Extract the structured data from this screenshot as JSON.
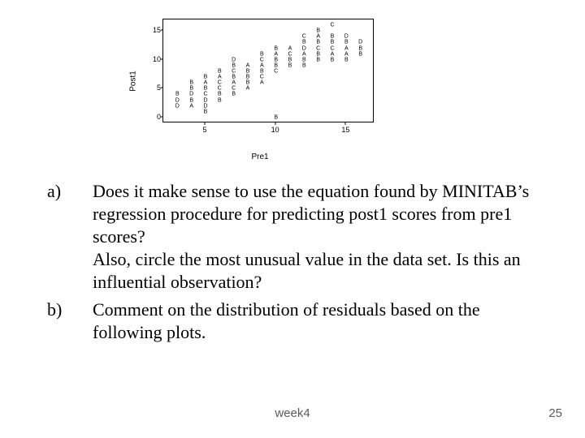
{
  "chart_data": {
    "type": "scatter",
    "title": "",
    "xlabel": "Pre1",
    "ylabel": "Post1",
    "xlim": [
      2,
      17
    ],
    "ylim": [
      -1,
      17
    ],
    "xticks": [
      5,
      10,
      15
    ],
    "yticks": [
      0,
      5,
      10,
      15
    ],
    "grid": false,
    "legend": false,
    "point_labels_note": "each point plotted with single-letter label",
    "points": [
      {
        "x": 3,
        "y": 4,
        "label": "B"
      },
      {
        "x": 3,
        "y": 3,
        "label": "D"
      },
      {
        "x": 3,
        "y": 2,
        "label": "D"
      },
      {
        "x": 4,
        "y": 6,
        "label": "B"
      },
      {
        "x": 4,
        "y": 5,
        "label": "B"
      },
      {
        "x": 4,
        "y": 4,
        "label": "D"
      },
      {
        "x": 4,
        "y": 3,
        "label": "B"
      },
      {
        "x": 4,
        "y": 2,
        "label": "A"
      },
      {
        "x": 5,
        "y": 7,
        "label": "B"
      },
      {
        "x": 5,
        "y": 6,
        "label": "A"
      },
      {
        "x": 5,
        "y": 5,
        "label": "B"
      },
      {
        "x": 5,
        "y": 4,
        "label": "C"
      },
      {
        "x": 5,
        "y": 3,
        "label": "D"
      },
      {
        "x": 5,
        "y": 2,
        "label": "D"
      },
      {
        "x": 5,
        "y": 1,
        "label": "B"
      },
      {
        "x": 6,
        "y": 8,
        "label": "B"
      },
      {
        "x": 6,
        "y": 7,
        "label": "A"
      },
      {
        "x": 6,
        "y": 6,
        "label": "C"
      },
      {
        "x": 6,
        "y": 5,
        "label": "C"
      },
      {
        "x": 6,
        "y": 4,
        "label": "B"
      },
      {
        "x": 6,
        "y": 3,
        "label": "B"
      },
      {
        "x": 7,
        "y": 10,
        "label": "D"
      },
      {
        "x": 7,
        "y": 9,
        "label": "B"
      },
      {
        "x": 7,
        "y": 8,
        "label": "C"
      },
      {
        "x": 7,
        "y": 7,
        "label": "B"
      },
      {
        "x": 7,
        "y": 6,
        "label": "A"
      },
      {
        "x": 7,
        "y": 5,
        "label": "C"
      },
      {
        "x": 7,
        "y": 4,
        "label": "B"
      },
      {
        "x": 8,
        "y": 9,
        "label": "A"
      },
      {
        "x": 8,
        "y": 8,
        "label": "B"
      },
      {
        "x": 8,
        "y": 7,
        "label": "B"
      },
      {
        "x": 8,
        "y": 6,
        "label": "B"
      },
      {
        "x": 8,
        "y": 5,
        "label": "A"
      },
      {
        "x": 9,
        "y": 11,
        "label": "B"
      },
      {
        "x": 9,
        "y": 10,
        "label": "C"
      },
      {
        "x": 9,
        "y": 9,
        "label": "A"
      },
      {
        "x": 9,
        "y": 8,
        "label": "B"
      },
      {
        "x": 9,
        "y": 7,
        "label": "C"
      },
      {
        "x": 9,
        "y": 6,
        "label": "A"
      },
      {
        "x": 10,
        "y": 12,
        "label": "B"
      },
      {
        "x": 10,
        "y": 11,
        "label": "A"
      },
      {
        "x": 10,
        "y": 10,
        "label": "B"
      },
      {
        "x": 10,
        "y": 9,
        "label": "B"
      },
      {
        "x": 10,
        "y": 8,
        "label": "C"
      },
      {
        "x": 10,
        "y": 0,
        "label": "B"
      },
      {
        "x": 11,
        "y": 12,
        "label": "A"
      },
      {
        "x": 11,
        "y": 11,
        "label": "C"
      },
      {
        "x": 11,
        "y": 10,
        "label": "B"
      },
      {
        "x": 11,
        "y": 9,
        "label": "B"
      },
      {
        "x": 12,
        "y": 14,
        "label": "C"
      },
      {
        "x": 12,
        "y": 13,
        "label": "B"
      },
      {
        "x": 12,
        "y": 12,
        "label": "D"
      },
      {
        "x": 12,
        "y": 11,
        "label": "A"
      },
      {
        "x": 12,
        "y": 10,
        "label": "B"
      },
      {
        "x": 12,
        "y": 9,
        "label": "B"
      },
      {
        "x": 13,
        "y": 15,
        "label": "B"
      },
      {
        "x": 13,
        "y": 14,
        "label": "A"
      },
      {
        "x": 13,
        "y": 13,
        "label": "B"
      },
      {
        "x": 13,
        "y": 12,
        "label": "C"
      },
      {
        "x": 13,
        "y": 11,
        "label": "B"
      },
      {
        "x": 13,
        "y": 10,
        "label": "B"
      },
      {
        "x": 14,
        "y": 16,
        "label": "C"
      },
      {
        "x": 14,
        "y": 14,
        "label": "B"
      },
      {
        "x": 14,
        "y": 13,
        "label": "B"
      },
      {
        "x": 14,
        "y": 12,
        "label": "C"
      },
      {
        "x": 14,
        "y": 11,
        "label": "A"
      },
      {
        "x": 14,
        "y": 10,
        "label": "B"
      },
      {
        "x": 15,
        "y": 14,
        "label": "D"
      },
      {
        "x": 15,
        "y": 13,
        "label": "B"
      },
      {
        "x": 15,
        "y": 12,
        "label": "A"
      },
      {
        "x": 15,
        "y": 11,
        "label": "A"
      },
      {
        "x": 15,
        "y": 10,
        "label": "B"
      },
      {
        "x": 16,
        "y": 13,
        "label": "D"
      },
      {
        "x": 16,
        "y": 12,
        "label": "B"
      },
      {
        "x": 16,
        "y": 11,
        "label": "B"
      }
    ]
  },
  "questions": {
    "a": {
      "label": "a)",
      "para1": "Does it make sense to use the equation found by MINITAB’s regression procedure for predicting post1 scores from pre1 scores?",
      "para2": "Also, circle the most unusual value in the data set. Is this an influential observation?"
    },
    "b": {
      "label": "b)",
      "text": "Comment on the distribution of residuals based on the following plots."
    }
  },
  "footer": {
    "center": "week4",
    "right": "25"
  }
}
